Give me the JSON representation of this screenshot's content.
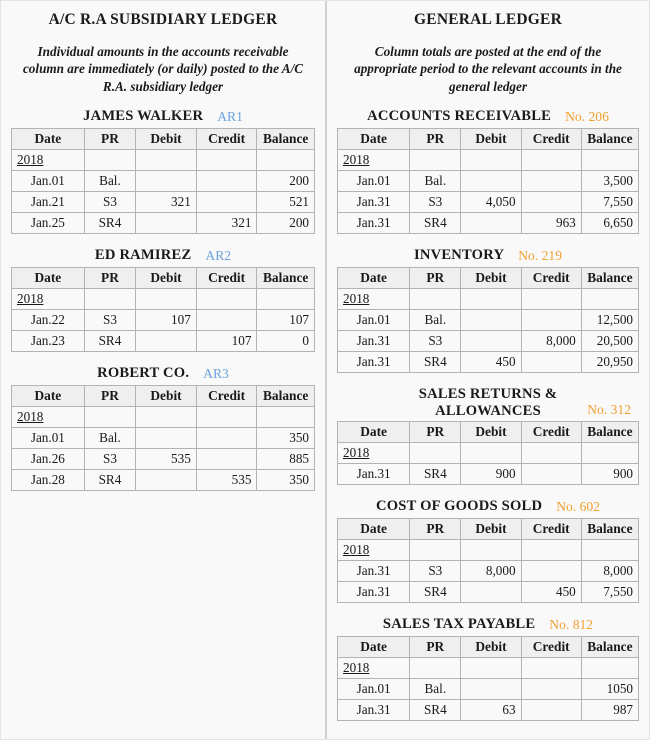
{
  "columns": {
    "left": {
      "title": "A/C R.A SUBSIDIARY LEDGER",
      "description": "Individual amounts in the accounts receivable column are immediately (or daily) posted to the A/C R.A. subsidiary ledger",
      "code_color": "#6aa3dd",
      "accounts": [
        {
          "name": "JAMES WALKER",
          "code": "AR1",
          "headers": [
            "Date",
            "PR",
            "Debit",
            "Credit",
            "Balance"
          ],
          "year": "2018",
          "rows": [
            {
              "date": "Jan.01",
              "pr": "Bal.",
              "debit": "",
              "credit": "",
              "balance": "200"
            },
            {
              "date": "Jan.21",
              "pr": "S3",
              "debit": "321",
              "credit": "",
              "balance": "521"
            },
            {
              "date": "Jan.25",
              "pr": "SR4",
              "debit": "",
              "credit": "321",
              "balance": "200"
            }
          ]
        },
        {
          "name": "ED RAMIREZ",
          "code": "AR2",
          "headers": [
            "Date",
            "PR",
            "Debit",
            "Credit",
            "Balance"
          ],
          "year": "2018",
          "rows": [
            {
              "date": "Jan.22",
              "pr": "S3",
              "debit": "107",
              "credit": "",
              "balance": "107"
            },
            {
              "date": "Jan.23",
              "pr": "SR4",
              "debit": "",
              "credit": "107",
              "balance": "0"
            }
          ]
        },
        {
          "name": "ROBERT CO.",
          "code": "AR3",
          "headers": [
            "Date",
            "PR",
            "Debit",
            "Credit",
            "Balance"
          ],
          "year": "2018",
          "rows": [
            {
              "date": "Jan.01",
              "pr": "Bal.",
              "debit": "",
              "credit": "",
              "balance": "350"
            },
            {
              "date": "Jan.26",
              "pr": "S3",
              "debit": "535",
              "credit": "",
              "balance": "885"
            },
            {
              "date": "Jan.28",
              "pr": "SR4",
              "debit": "",
              "credit": "535",
              "balance": "350"
            }
          ]
        }
      ]
    },
    "right": {
      "title": "GENERAL LEDGER",
      "description": "Column totals are posted at the end of the appropriate period to the relevant accounts in the general ledger",
      "code_color": "#f0a030",
      "accounts": [
        {
          "name": "ACCOUNTS RECEIVABLE",
          "code": "No. 206",
          "two_line": false,
          "headers": [
            "Date",
            "PR",
            "Debit",
            "Credit",
            "Balance"
          ],
          "year": "2018",
          "rows": [
            {
              "date": "Jan.01",
              "pr": "Bal.",
              "debit": "",
              "credit": "",
              "balance": "3,500"
            },
            {
              "date": "Jan.31",
              "pr": "S3",
              "debit": "4,050",
              "credit": "",
              "balance": "7,550"
            },
            {
              "date": "Jan.31",
              "pr": "SR4",
              "debit": "",
              "credit": "963",
              "balance": "6,650"
            }
          ]
        },
        {
          "name": "INVENTORY",
          "code": "No. 219",
          "two_line": false,
          "headers": [
            "Date",
            "PR",
            "Debit",
            "Credit",
            "Balance"
          ],
          "year": "2018",
          "rows": [
            {
              "date": "Jan.01",
              "pr": "Bal.",
              "debit": "",
              "credit": "",
              "balance": "12,500"
            },
            {
              "date": "Jan.31",
              "pr": "S3",
              "debit": "",
              "credit": "8,000",
              "balance": "20,500"
            },
            {
              "date": "Jan.31",
              "pr": "SR4",
              "debit": "450",
              "credit": "",
              "balance": "20,950"
            }
          ]
        },
        {
          "name": "SALES RETURNS & ALLOWANCES",
          "name_line1": "SALES RETURNS &",
          "name_line2": "ALLOWANCES",
          "code": "No. 312",
          "two_line": true,
          "headers": [
            "Date",
            "PR",
            "Debit",
            "Credit",
            "Balance"
          ],
          "year": "2018",
          "rows": [
            {
              "date": "Jan.31",
              "pr": "SR4",
              "debit": "900",
              "credit": "",
              "balance": "900"
            }
          ]
        },
        {
          "name": "COST OF GOODS SOLD",
          "code": "No. 602",
          "two_line": false,
          "headers": [
            "Date",
            "PR",
            "Debit",
            "Credit",
            "Balance"
          ],
          "year": "2018",
          "rows": [
            {
              "date": "Jan.31",
              "pr": "S3",
              "debit": "8,000",
              "credit": "",
              "balance": "8,000"
            },
            {
              "date": "Jan.31",
              "pr": "SR4",
              "debit": "",
              "credit": "450",
              "balance": "7,550"
            }
          ]
        },
        {
          "name": "SALES TAX PAYABLE",
          "code": "No. 812",
          "two_line": false,
          "headers": [
            "Date",
            "PR",
            "Debit",
            "Credit",
            "Balance"
          ],
          "year": "2018",
          "rows": [
            {
              "date": "Jan.01",
              "pr": "Bal.",
              "debit": "",
              "credit": "",
              "balance": "1050"
            },
            {
              "date": "Jan.31",
              "pr": "SR4",
              "debit": "63",
              "credit": "",
              "balance": "987"
            }
          ]
        }
      ]
    }
  }
}
